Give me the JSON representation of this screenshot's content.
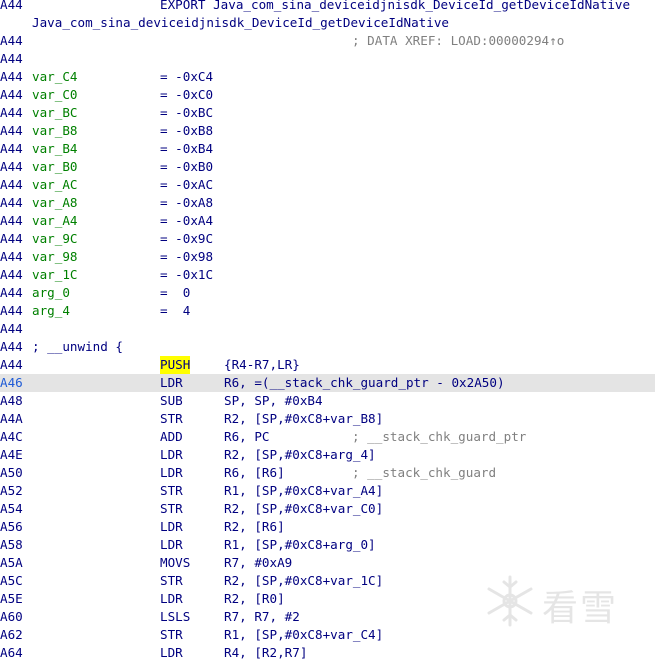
{
  "header": {
    "export_addr": "A44",
    "export_text": "EXPORT Java_com_sina_deviceidjnisdk_DeviceId_getDeviceIdNative",
    "func_name": "Java_com_sina_deviceidjnisdk_DeviceId_getDeviceIdNative",
    "xref_addr": "A44",
    "xref_text": "; DATA XREF: LOAD:00000294↑o",
    "blank_addr": "A44"
  },
  "vars": [
    {
      "addr": "A44",
      "name": "var_C4",
      "value": "= -0xC4"
    },
    {
      "addr": "A44",
      "name": "var_C0",
      "value": "= -0xC0"
    },
    {
      "addr": "A44",
      "name": "var_BC",
      "value": "= -0xBC"
    },
    {
      "addr": "A44",
      "name": "var_B8",
      "value": "= -0xB8"
    },
    {
      "addr": "A44",
      "name": "var_B4",
      "value": "= -0xB4"
    },
    {
      "addr": "A44",
      "name": "var_B0",
      "value": "= -0xB0"
    },
    {
      "addr": "A44",
      "name": "var_AC",
      "value": "= -0xAC"
    },
    {
      "addr": "A44",
      "name": "var_A8",
      "value": "= -0xA8"
    },
    {
      "addr": "A44",
      "name": "var_A4",
      "value": "= -0xA4"
    },
    {
      "addr": "A44",
      "name": "var_9C",
      "value": "= -0x9C"
    },
    {
      "addr": "A44",
      "name": "var_98",
      "value": "= -0x98"
    },
    {
      "addr": "A44",
      "name": "var_1C",
      "value": "= -0x1C"
    },
    {
      "addr": "A44",
      "name": "arg_0",
      "value": "=  0"
    },
    {
      "addr": "A44",
      "name": "arg_4",
      "value": "=  4"
    }
  ],
  "unwind": {
    "addr": "A44",
    "text": "; __unwind {"
  },
  "instructions": [
    {
      "addr": "A44",
      "mn": "PUSH",
      "op": "{R4-R7,LR}",
      "cmt": ""
    },
    {
      "addr": "A46",
      "mn": "LDR",
      "op": "R6, =(__stack_chk_guard_ptr - 0x2A50)",
      "cmt": ""
    },
    {
      "addr": "A48",
      "mn": "SUB",
      "op": "SP, SP, #0xB4",
      "cmt": ""
    },
    {
      "addr": "A4A",
      "mn": "STR",
      "op": "R2, [SP,#0xC8+var_B8]",
      "cmt": ""
    },
    {
      "addr": "A4C",
      "mn": "ADD",
      "op": "R6, PC",
      "cmt": "; __stack_chk_guard_ptr"
    },
    {
      "addr": "A4E",
      "mn": "LDR",
      "op": "R2, [SP,#0xC8+arg_4]",
      "cmt": ""
    },
    {
      "addr": "A50",
      "mn": "LDR",
      "op": "R6, [R6]",
      "cmt": "; __stack_chk_guard"
    },
    {
      "addr": "A52",
      "mn": "STR",
      "op": "R1, [SP,#0xC8+var_A4]",
      "cmt": ""
    },
    {
      "addr": "A54",
      "mn": "STR",
      "op": "R2, [SP,#0xC8+var_C0]",
      "cmt": ""
    },
    {
      "addr": "A56",
      "mn": "LDR",
      "op": "R2, [R6]",
      "cmt": ""
    },
    {
      "addr": "A58",
      "mn": "LDR",
      "op": "R1, [SP,#0xC8+arg_0]",
      "cmt": ""
    },
    {
      "addr": "A5A",
      "mn": "MOVS",
      "op": "R7, #0xA9",
      "cmt": ""
    },
    {
      "addr": "A5C",
      "mn": "STR",
      "op": "R2, [SP,#0xC8+var_1C]",
      "cmt": ""
    },
    {
      "addr": "A5E",
      "mn": "LDR",
      "op": "R2, [R0]",
      "cmt": ""
    },
    {
      "addr": "A60",
      "mn": "LSLS",
      "op": "R7, R7, #2",
      "cmt": ""
    },
    {
      "addr": "A62",
      "mn": "STR",
      "op": "R1, [SP,#0xC8+var_C4]",
      "cmt": ""
    },
    {
      "addr": "A64",
      "mn": "LDR",
      "op": "R4, [R2,R7]",
      "cmt": ""
    }
  ],
  "watermark": {
    "text": "看雪",
    "icon": "snowflake-logo-icon"
  },
  "colors": {
    "highlight": "#ffff00",
    "cursor_line": "#e4e4e4",
    "var_name": "#008000",
    "code": "#000080",
    "comment": "#808080"
  }
}
